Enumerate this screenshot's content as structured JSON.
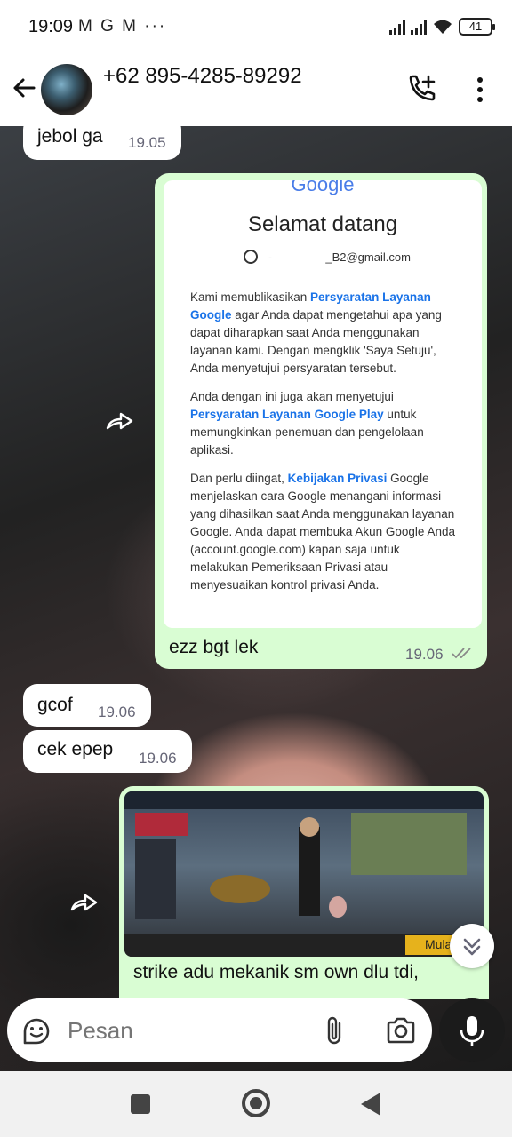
{
  "status_bar": {
    "time": "19:09",
    "app_icons": "M G M ···",
    "battery": "41"
  },
  "header": {
    "contact": "+62 895-4285-89292"
  },
  "messages": [
    {
      "direction": "in",
      "text": "jebol ga",
      "time": "19.05"
    },
    {
      "direction": "out",
      "forwarded": true,
      "attachment": {
        "logo": "Google",
        "title": "Selamat datang",
        "account_prefix": "-",
        "account": "_B2@gmail.com",
        "p1_a": "Kami memublikasikan ",
        "p1_link": "Persyaratan Layanan Google",
        "p1_b": " agar Anda dapat mengetahui apa yang dapat diharapkan saat Anda menggunakan layanan kami. Dengan mengklik 'Saya Setuju', Anda menyetujui persyaratan tersebut.",
        "p2_a": "Anda dengan ini juga akan menyetujui ",
        "p2_link": "Persyaratan Layanan Google Play",
        "p2_b": " untuk memungkinkan penemuan dan pengelolaan aplikasi.",
        "p3_a": "Dan perlu diingat, ",
        "p3_link": "Kebijakan Privasi",
        "p3_b": " Google menjelaskan cara Google menangani informasi yang dihasilkan saat Anda menggunakan layanan Google. Anda dapat membuka Akun Google Anda (account.google.com) kapan saja untuk melakukan Pemeriksaan Privasi atau menyesuaikan kontrol privasi Anda."
      },
      "text": "ezz bgt lek",
      "time": "19.06",
      "status": "read"
    },
    {
      "direction": "in",
      "text": "gcof",
      "time": "19.06"
    },
    {
      "direction": "in",
      "text": "cek epep",
      "time": "19.06"
    },
    {
      "direction": "out",
      "forwarded": true,
      "image": "game-screenshot",
      "image_button": "Mulai",
      "text": "strike adu mekanik sm own dlu tdi,"
    }
  ],
  "composer": {
    "placeholder": "Pesan"
  },
  "colors": {
    "outgoing_bubble": "#d9fdd3",
    "incoming_bubble": "#ffffff",
    "link": "#1a73e8",
    "read_ticks": "#53bdeb"
  }
}
